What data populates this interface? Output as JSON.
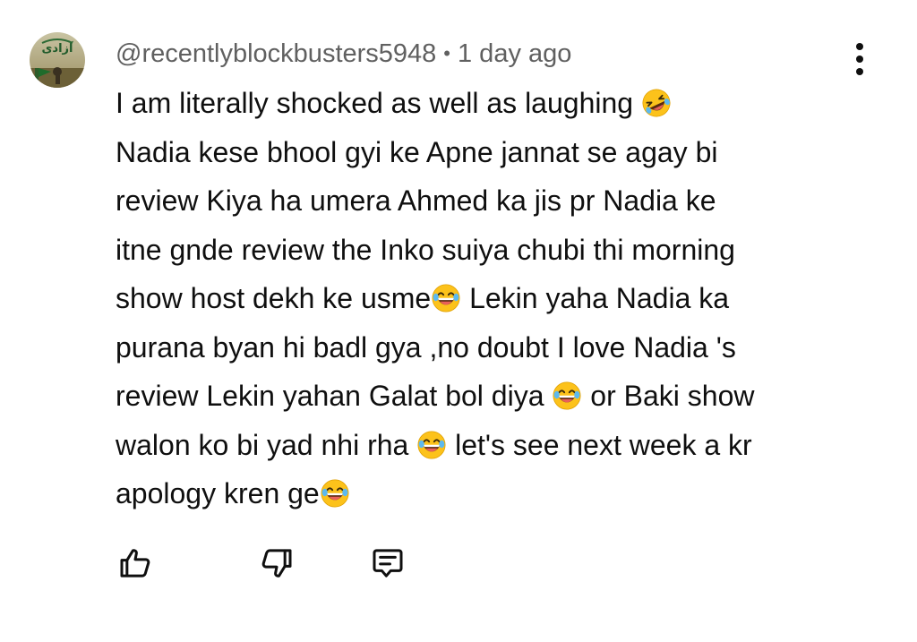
{
  "comment": {
    "author": "@recentlyblockbusters5948",
    "separator": "•",
    "time": "1 day ago",
    "avatar_icon": "avatar-azadi-flag-icon",
    "lines": [
      {
        "text": "I am literally shocked as well as laughing ",
        "emoji_after": "rofl"
      },
      {
        "text": "Nadia kese bhool gyi ke Apne jannat se agay bi"
      },
      {
        "text": "review Kiya ha umera Ahmed ka jis pr Nadia ke"
      },
      {
        "text": "itne gnde review the Inko suiya chubi thi morning"
      },
      {
        "text": "show host dekh ke usme",
        "emoji_after": "joy",
        "text2": " Lekin yaha Nadia ka"
      },
      {
        "text": "purana byan hi badl gya ,no doubt I love Nadia 's"
      },
      {
        "text": "review Lekin yahan Galat bol diya ",
        "emoji_after": "joy",
        "text2": " or Baki show"
      },
      {
        "text": "walon ko bi yad nhi rha ",
        "emoji_after": "joy",
        "text2": " let's see next week a kr"
      },
      {
        "text": "apology kren ge",
        "emoji_after": "joy"
      }
    ]
  },
  "actions": {
    "like_icon": "thumbs-up-icon",
    "dislike_icon": "thumbs-down-icon",
    "reply_icon": "comment-reply-icon",
    "menu_icon": "more-vert-icon"
  },
  "colors": {
    "text": "#0f0f0f",
    "meta": "#606060",
    "emoji_face": "#fcc21b"
  }
}
